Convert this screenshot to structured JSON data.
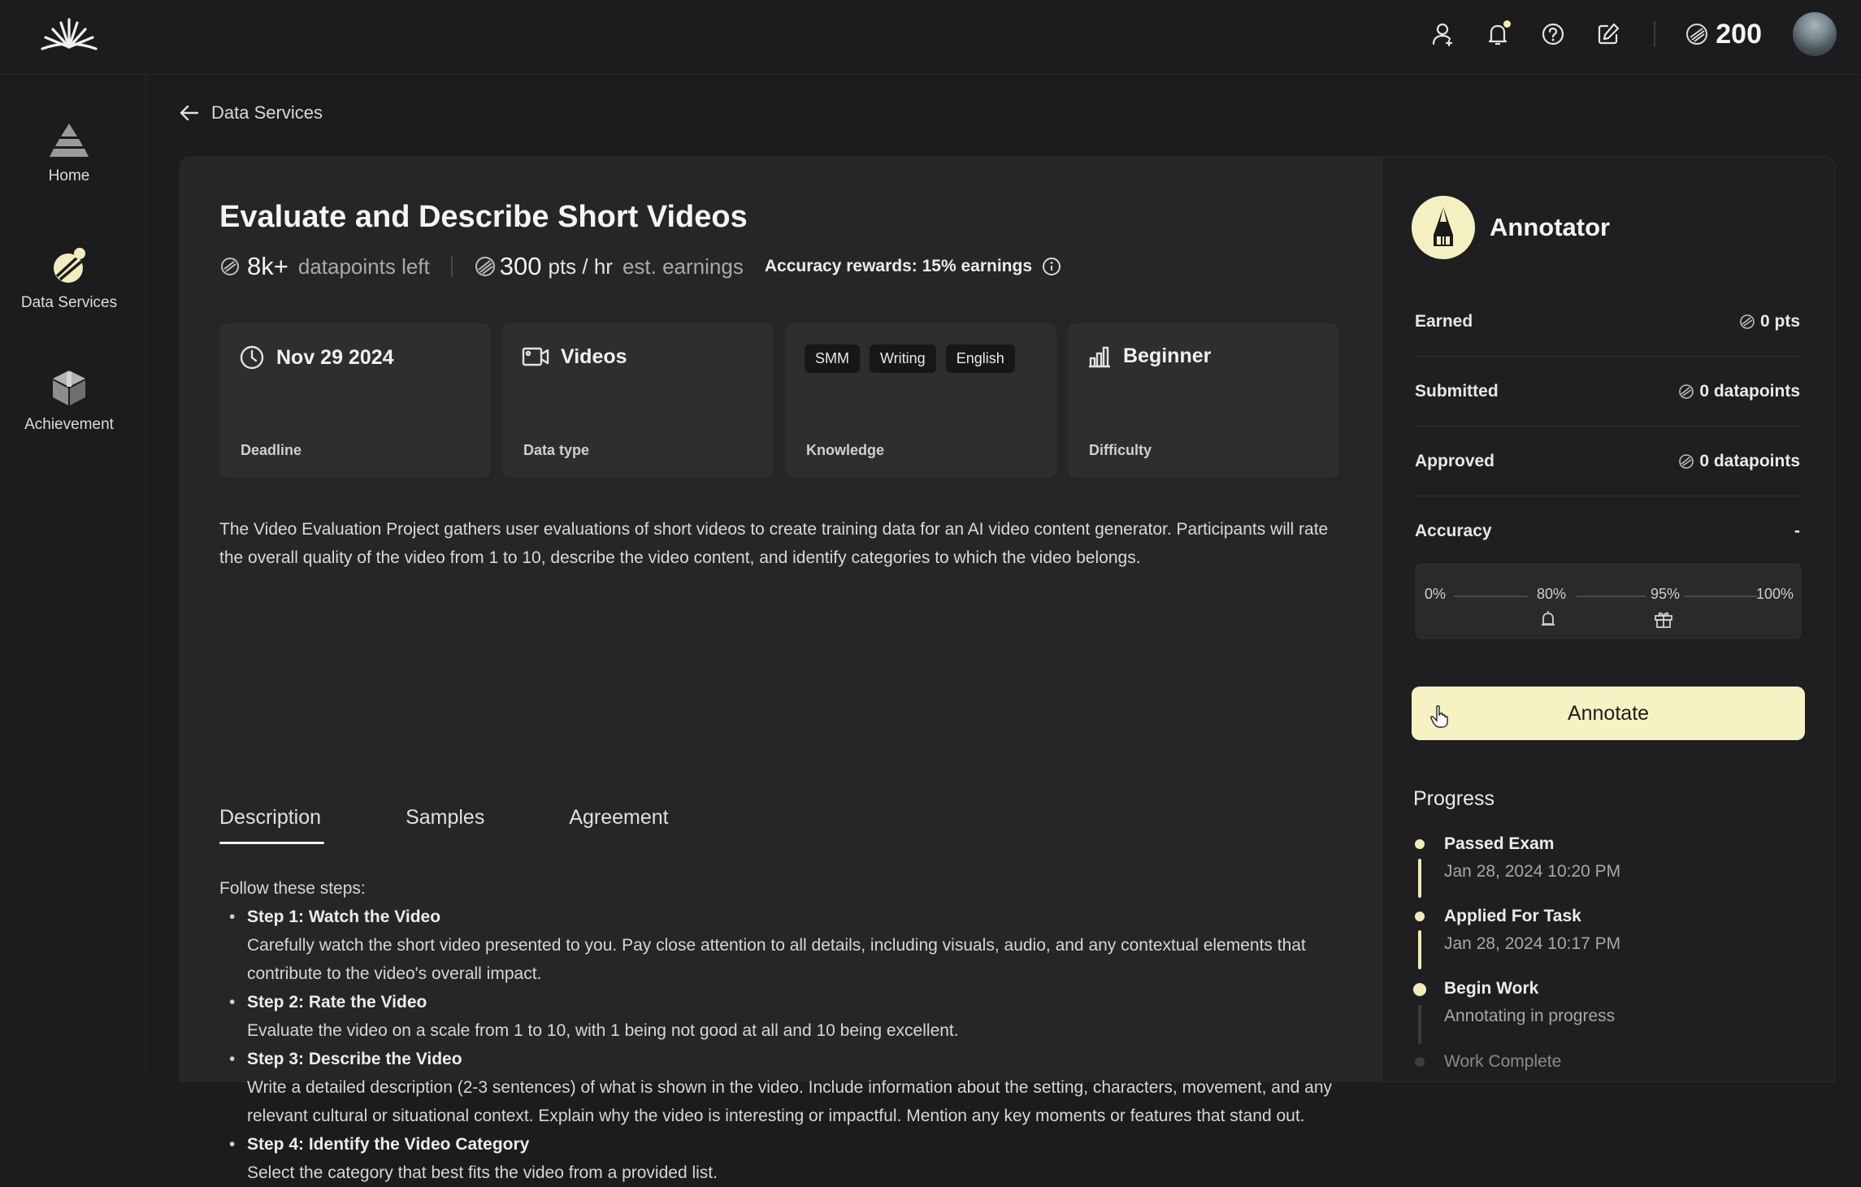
{
  "header": {
    "points": "200",
    "icons": [
      "user-icon",
      "bell-icon",
      "help-icon",
      "edit-icon",
      "points-icon",
      "avatar"
    ]
  },
  "sidebar": {
    "items": [
      {
        "label": "Home",
        "icon": "pyramid-icon"
      },
      {
        "label": "Data Services",
        "icon": "data-services-icon"
      },
      {
        "label": "Achievement",
        "icon": "cube-icon"
      }
    ]
  },
  "breadcrumb": {
    "label": "Data Services"
  },
  "task": {
    "title": "Evaluate and Describe Short Videos",
    "datapoints_left": "8k+",
    "datapoints_left_label": "datapoints left",
    "rate": "300",
    "rate_unit": "pts / hr",
    "rate_label": "est. earnings",
    "accuracy_rewards": "Accuracy rewards: 15% earnings",
    "cards": {
      "deadline_value": "Nov 29 2024",
      "deadline_label": "Deadline",
      "datatype_value": "Videos",
      "datatype_label": "Data type",
      "knowledge_tags": [
        "SMM",
        "Writing",
        "English"
      ],
      "knowledge_label": "Knowledge",
      "difficulty_value": "Beginner",
      "difficulty_label": "Difficulty"
    },
    "description": "The Video Evaluation Project gathers user evaluations of short videos to create training data for an AI video content generator. Participants will rate the overall quality of the video from 1 to 10, describe the video content, and identify categories to which the video belongs.",
    "tabs": [
      "Description",
      "Samples",
      "Agreement"
    ],
    "active_tab": "Description",
    "steps_intro": "Follow these steps:",
    "steps": [
      {
        "title": "Step 1: Watch the Video",
        "text": "Carefully watch the short video presented to you. Pay close attention to all details, including visuals, audio, and any contextual elements that contribute to the video's overall impact."
      },
      {
        "title": "Step 2: Rate the Video",
        "text": "Evaluate the video on a scale from 1 to 10, with 1 being not good at all and 10 being excellent."
      },
      {
        "title": "Step 3: Describe the Video",
        "text": "Write a detailed description (2-3 sentences) of what is shown in the video. Include information about the setting, characters, movement, and any relevant cultural or situational context. Explain why the video is interesting or impactful. Mention any key moments or features that stand out."
      },
      {
        "title": "Step 4: Identify the Video Category",
        "text": "Select the category that best fits the video from a provided list."
      }
    ]
  },
  "annotator": {
    "title": "Annotator",
    "stats": [
      {
        "label": "Earned",
        "value": "0 pts"
      },
      {
        "label": "Submitted",
        "value": "0 datapoints"
      },
      {
        "label": "Approved",
        "value": "0 datapoints"
      },
      {
        "label": "Accuracy",
        "value": "-"
      }
    ],
    "accuracy_ticks": [
      "0%",
      "80%",
      "95%",
      "100%"
    ],
    "button": "Annotate",
    "progress_title": "Progress",
    "progress": [
      {
        "title": "Passed Exam",
        "sub": "Jan 28, 2024 10:20 PM"
      },
      {
        "title": "Applied For Task",
        "sub": "Jan 28, 2024 10:17 PM"
      },
      {
        "title": "Begin Work",
        "sub": "Annotating in progress"
      },
      {
        "title": "Work Complete",
        "sub": ""
      }
    ]
  },
  "colors": {
    "accent": "#f6f2c4",
    "background": "#1c1c1e",
    "panel": "#262628"
  }
}
